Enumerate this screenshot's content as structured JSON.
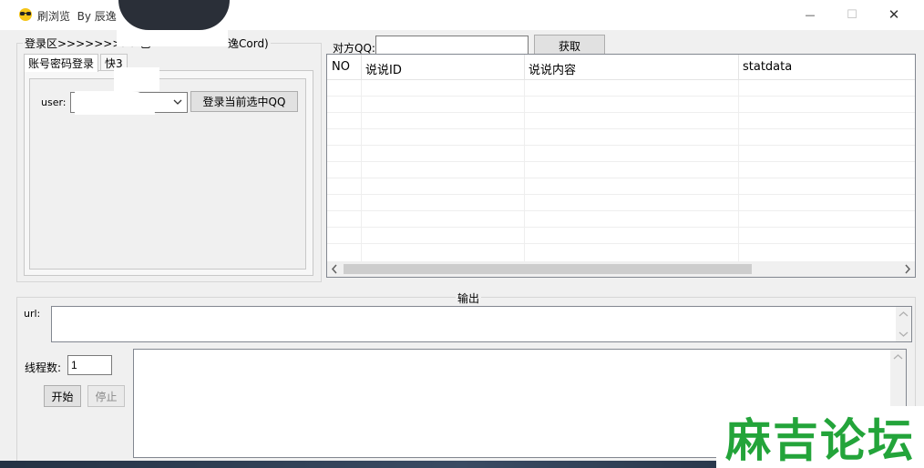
{
  "window": {
    "title": "刷浏览  By 辰逸",
    "minimize_glyph": "—",
    "maximize_glyph": "☐",
    "close_glyph": "✕"
  },
  "login": {
    "group_label": "登录区>>>>>>>>>已",
    "group_label_tail": "逸Cord)",
    "tabs": [
      "账号密码登录",
      "快3"
    ],
    "user_label": "user:",
    "login_button": "登录当前选中QQ"
  },
  "target": {
    "qq_label": "对方QQ:",
    "qq_value": "",
    "fetch_button": "获取"
  },
  "table": {
    "columns": [
      "NO",
      "说说ID",
      "说说内容",
      "statdata"
    ],
    "rows": []
  },
  "output": {
    "group_label": "输出",
    "url_label": "url:",
    "url_value": "",
    "threads_label": "线程数:",
    "threads_value": "1",
    "start_button": "开始",
    "stop_button": "停止",
    "log_text": ""
  },
  "watermark": "麻吉论坛"
}
